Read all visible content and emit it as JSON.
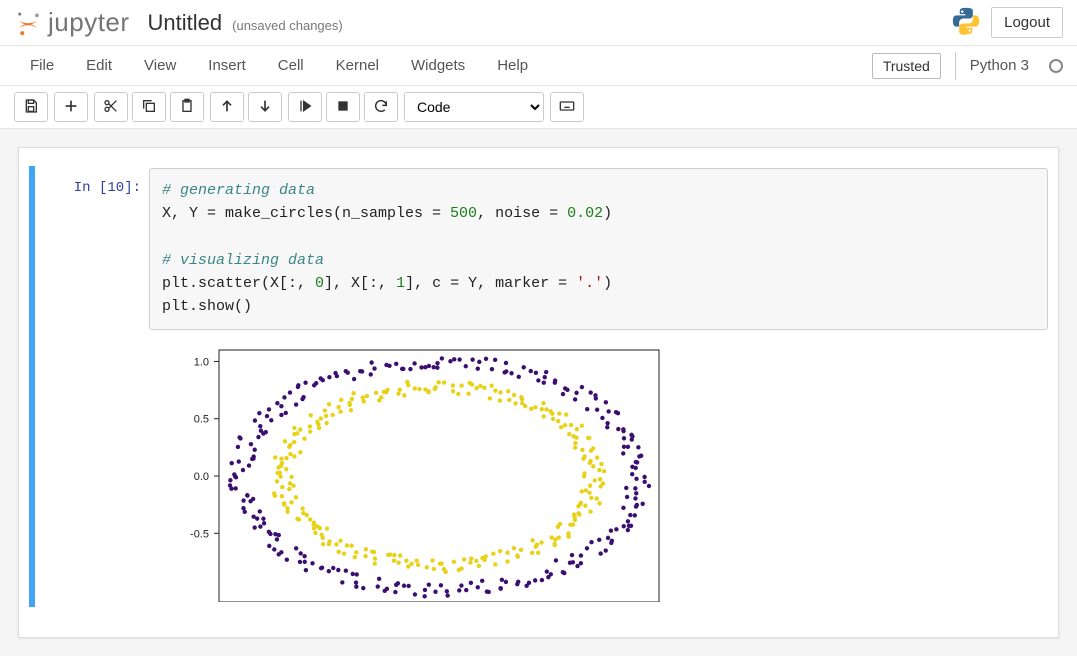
{
  "header": {
    "logo_text": "jupyter",
    "notebook_title": "Untitled",
    "save_status": "(unsaved changes)",
    "logout_label": "Logout"
  },
  "menubar": {
    "items": [
      "File",
      "Edit",
      "View",
      "Insert",
      "Cell",
      "Kernel",
      "Widgets",
      "Help"
    ],
    "trusted_label": "Trusted",
    "kernel_name": "Python 3"
  },
  "toolbar": {
    "icons": {
      "save": "save-icon",
      "add": "plus-icon",
      "cut": "scissors-icon",
      "copy": "copy-icon",
      "paste": "paste-icon",
      "up": "arrow-up-icon",
      "down": "arrow-down-icon",
      "run": "run-icon",
      "interrupt": "stop-icon",
      "restart": "refresh-icon",
      "cmd": "keyboard-icon"
    },
    "celltype_selected": "Code"
  },
  "cell": {
    "prompt": "In [10]:",
    "code": {
      "l1_comment": "# generating data",
      "l2_a": "X, Y = make_circles(n_samples = ",
      "l2_num1": "500",
      "l2_b": ", noise = ",
      "l2_num2": "0.02",
      "l2_c": ")",
      "l3_blank": "",
      "l4_comment": "# visualizing data",
      "l5_a": "plt.scatter(X[:, ",
      "l5_num1": "0",
      "l5_b": "], X[:, ",
      "l5_num2": "1",
      "l5_c": "], c = Y, marker = ",
      "l5_str": "'.'",
      "l5_d": ")",
      "l6": "plt.show()"
    }
  },
  "chart_data": {
    "type": "scatter",
    "title": "",
    "xlabel": "",
    "ylabel": "",
    "xlim": [
      -1.1,
      1.1
    ],
    "ylim": [
      -1.1,
      1.1
    ],
    "yticks_visible": [
      -0.5,
      0.0,
      0.5,
      1.0
    ],
    "series": [
      {
        "name": "Y=0 (outer circle)",
        "color": "#3b0f70",
        "radius_mean": 1.0,
        "noise": 0.02,
        "n": 250
      },
      {
        "name": "Y=1 (inner circle)",
        "color": "#e8d219",
        "radius_mean": 0.78,
        "noise": 0.02,
        "n": 250
      }
    ]
  }
}
